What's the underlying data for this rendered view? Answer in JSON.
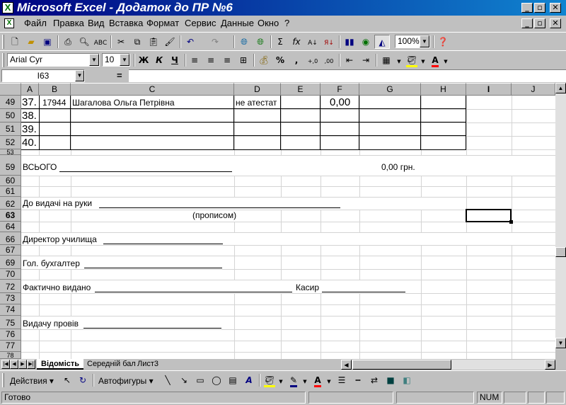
{
  "window": {
    "title": "Microsoft Excel - Додаток до ПР №6",
    "app_icon": "X",
    "minimize": "_",
    "restore": "▫",
    "close": "✕"
  },
  "menu": {
    "items": [
      "Файл",
      "Правка",
      "Вид",
      "Вставка",
      "Формат",
      "Сервис",
      "Данные",
      "Окно",
      "?"
    ]
  },
  "toolbar": {
    "zoom": "100%",
    "font_name": "Arial Cyr",
    "font_size": "10",
    "bold": "Ж",
    "italic": "К",
    "underline": "Ч",
    "autosum": "Σ",
    "function": "fx",
    "percent": "%",
    "comma": ","
  },
  "formula_bar": {
    "name_box": "I63",
    "equals": "="
  },
  "columns": [
    "A",
    "B",
    "C",
    "D",
    "E",
    "F",
    "G",
    "H",
    "I",
    "J"
  ],
  "active_column": "I",
  "rows": {
    "r49": "49",
    "r50": "50",
    "r51": "51",
    "r52": "52",
    "r53": "53",
    "r59": "59",
    "r60": "60",
    "r61": "61",
    "r62": "62",
    "r63": "63",
    "r64": "64",
    "r66": "66",
    "r67": "67",
    "r69": "69",
    "r70": "70",
    "r72": "72",
    "r73": "73",
    "r74": "74",
    "r75": "75",
    "r76": "76",
    "r77": "77",
    "r78": "78"
  },
  "cells": {
    "a49": "37.",
    "b49": "17944",
    "c49": "Шагалова Ольга Петрівна",
    "d49": "не атестат",
    "f49": "0,00",
    "a50": "38.",
    "a51": "39.",
    "a52": "40.",
    "a59": "ВСЬОГО",
    "g59": "0,00 грн.",
    "a62": "До видачі на руки",
    "c63": "(прописом)",
    "a66": "Директор училища",
    "a69": "Гол. бухгалтер",
    "a72": "Фактично видано",
    "kasir": "Касир",
    "a75": "Видачу провів"
  },
  "sheets": [
    "Відомість",
    "Середній бал",
    "Лист3"
  ],
  "drawing": {
    "actions": "Действия",
    "autoshapes": "Автофигуры"
  },
  "status": {
    "ready": "Готово",
    "num": "NUM"
  }
}
